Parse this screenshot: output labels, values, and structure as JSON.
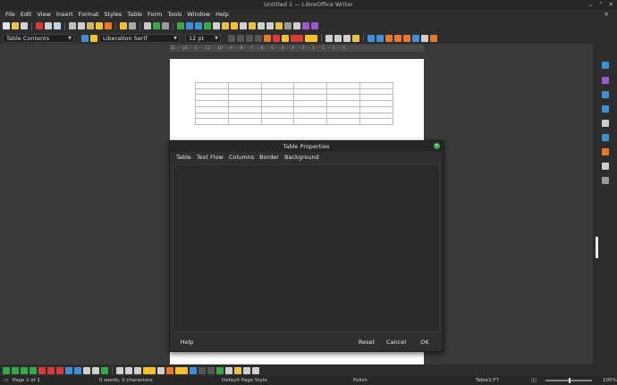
{
  "window": {
    "title": "Untitled 1 — LibreOffice Writer",
    "minimize": "⌄",
    "maximize": "⌃",
    "close": "✕"
  },
  "menu": {
    "items": [
      "File",
      "Edit",
      "View",
      "Insert",
      "Format",
      "Styles",
      "Table",
      "Form",
      "Tools",
      "Window",
      "Help"
    ],
    "close_doc": "✕"
  },
  "formatting": {
    "paragraph_style": "Table Contents",
    "font_name": "Liberation Serif",
    "font_size": "12 pt"
  },
  "ruler": {
    "ticks": "13 · · · 14 · · · 1 · · · 11 · · · 10 · · · 9 · · · 8 · · · 7 · · · 6 · · · 5 · · · 4 · · · 3 · · · 2 · · · 1 · · · 1 · · · 2 · · · 3"
  },
  "dialog": {
    "title": "Table Properties",
    "tabs": [
      "Table",
      "Text Flow",
      "Columns",
      "Border",
      "Background"
    ],
    "help_label": "Help",
    "reset_label": "Reset",
    "cancel_label": "Cancel",
    "ok_label": "OK"
  },
  "status": {
    "page": "Page 1 of 1",
    "words": "0 words, 0 characters",
    "page_style": "Default Page Style",
    "language": "Polish",
    "cell": "Table1:F7",
    "zoom": "100%"
  },
  "colors": {
    "accent_green": "#36a84a",
    "accent_orange": "#e8782a",
    "accent_red": "#d83b3b",
    "accent_yellow": "#f2c12e",
    "accent_blue": "#3f8fd6",
    "accent_purple": "#9b59d0"
  }
}
